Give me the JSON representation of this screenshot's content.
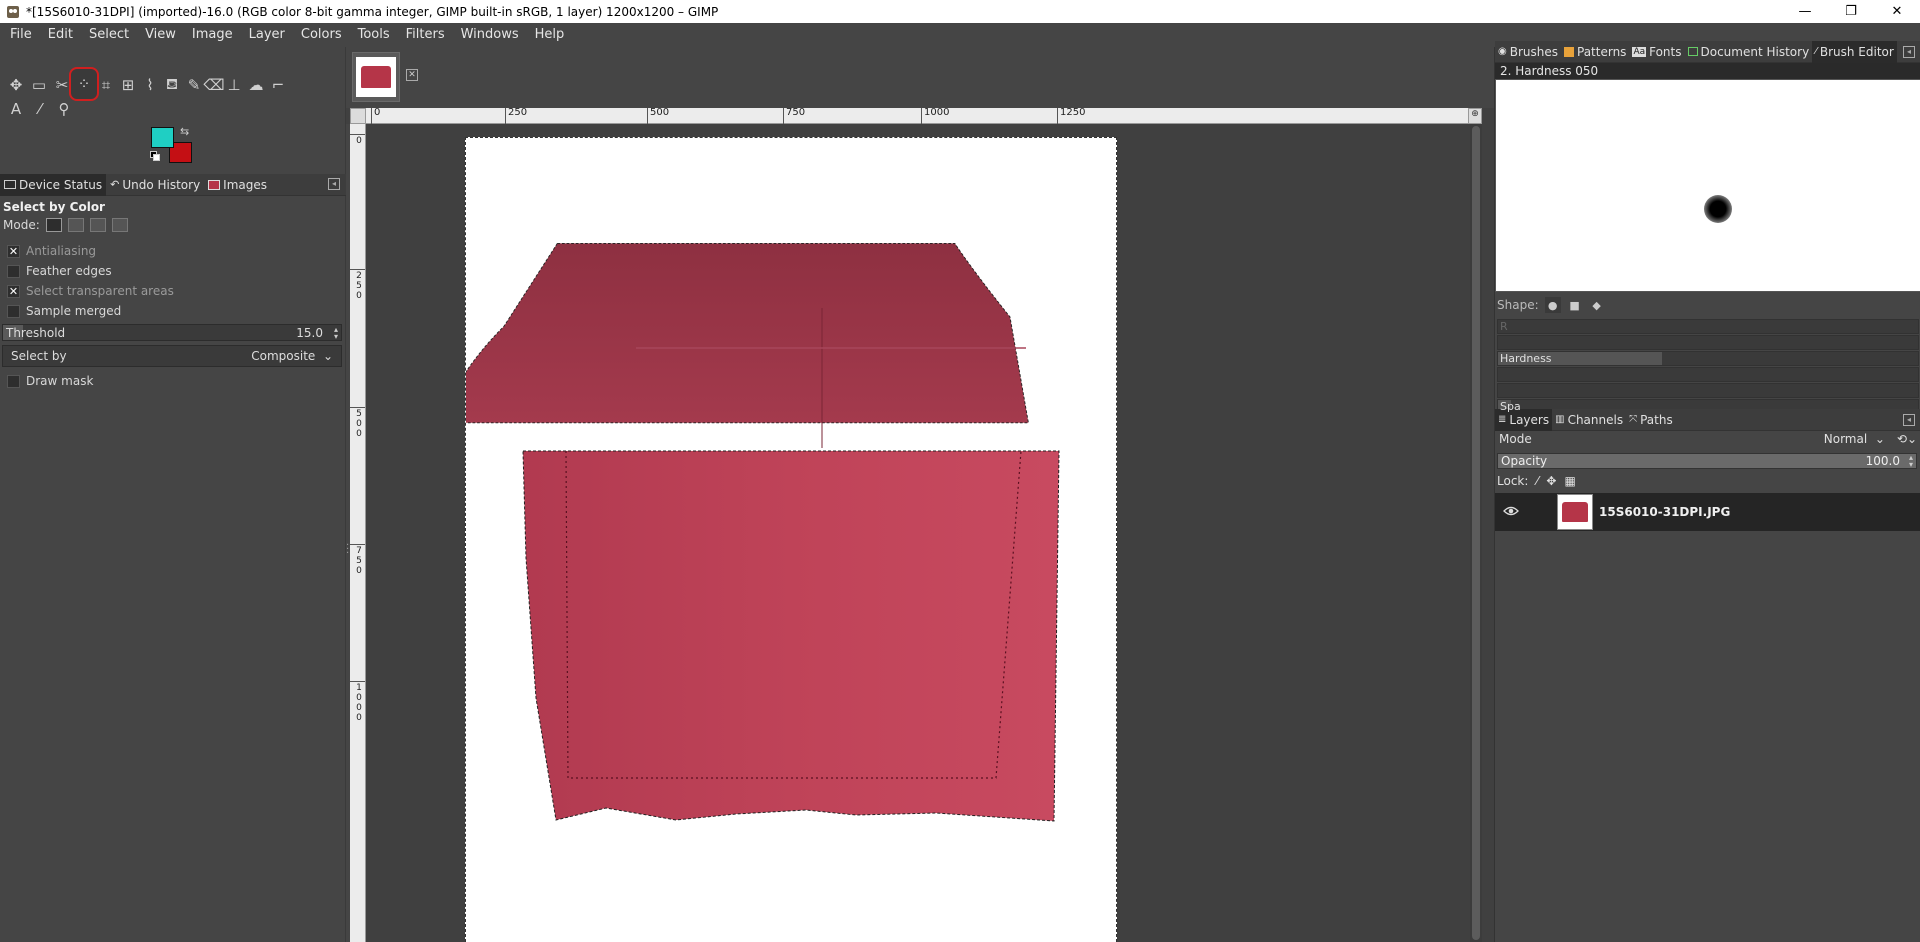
{
  "window": {
    "title": "*[15S6010-31DPI] (imported)-16.0 (RGB color 8-bit gamma integer, GIMP built-in sRGB, 1 layer) 1200x1200 – GIMP",
    "controls": [
      "—",
      "❐",
      "✕"
    ]
  },
  "menu": [
    "File",
    "Edit",
    "Select",
    "View",
    "Image",
    "Layer",
    "Colors",
    "Tools",
    "Filters",
    "Windows",
    "Help"
  ],
  "colors": {
    "foreground": "#1fcfc3",
    "background": "#c40f14",
    "accent": "#d01f1f"
  },
  "toolbox": {
    "tools": [
      {
        "name": "move-tool-icon",
        "glyph": "✥",
        "active": false
      },
      {
        "name": "rect-select-tool-icon",
        "glyph": "▭",
        "active": false
      },
      {
        "name": "scissors-select-tool-icon",
        "glyph": "✂",
        "active": false
      },
      {
        "name": "select-by-color-tool-icon",
        "glyph": "⁘",
        "active": true
      },
      {
        "name": "crop-tool-icon",
        "glyph": "⌗",
        "active": false
      },
      {
        "name": "unified-transform-tool-icon",
        "glyph": "⊞",
        "active": false
      },
      {
        "name": "warp-transform-tool-icon",
        "glyph": "⌇",
        "active": false
      },
      {
        "name": "bucket-fill-tool-icon",
        "glyph": "⛾",
        "active": false
      },
      {
        "name": "paintbrush-tool-icon",
        "glyph": "✎",
        "active": false
      },
      {
        "name": "eraser-tool-icon",
        "glyph": "⌫",
        "active": false
      },
      {
        "name": "clone-tool-icon",
        "glyph": "⊥",
        "active": false
      },
      {
        "name": "smudge-tool-icon",
        "glyph": "☁",
        "active": false
      },
      {
        "name": "paths-tool-icon",
        "glyph": "⌐",
        "active": false
      },
      {
        "name": "text-tool-icon",
        "glyph": "A",
        "active": false
      },
      {
        "name": "color-picker-tool-icon",
        "glyph": "⁄",
        "active": false
      },
      {
        "name": "zoom-tool-icon",
        "glyph": "⚲",
        "active": false
      }
    ]
  },
  "left_tabs": [
    {
      "label": "Device Status",
      "selected": true
    },
    {
      "label": "Undo History",
      "selected": false
    },
    {
      "label": "Images",
      "selected": false
    }
  ],
  "tool_options": {
    "title": "Select by Color",
    "mode_label": "Mode:",
    "antialiasing": {
      "label": "Antialiasing",
      "checked": true
    },
    "feather": {
      "label": "Feather edges",
      "checked": false
    },
    "transparent": {
      "label": "Select transparent areas",
      "checked": true
    },
    "sample_merged": {
      "label": "Sample merged",
      "checked": false
    },
    "threshold": {
      "label": "Threshold",
      "value": "15.0",
      "fraction": 0.06
    },
    "select_by": {
      "label": "Select by",
      "value": "Composite"
    },
    "draw_mask": {
      "label": "Draw mask",
      "checked": false
    }
  },
  "rulers": {
    "top": [
      "0",
      "250",
      "500",
      "750",
      "1000",
      "1250"
    ],
    "left": [
      "0",
      "250",
      "500",
      "750",
      "1000"
    ]
  },
  "right_tabs": [
    {
      "label": "Brushes",
      "selected": false
    },
    {
      "label": "Patterns",
      "selected": false
    },
    {
      "label": "Fonts",
      "selected": false
    },
    {
      "label": "Document History",
      "selected": false
    },
    {
      "label": "Brush Editor",
      "selected": true
    }
  ],
  "brush_editor": {
    "brush_name": "2. Hardness 050",
    "shape_label": "Shape:",
    "params": [
      {
        "label": "R",
        "bright": false,
        "fill": 0.0
      },
      {
        "label": "",
        "bright": false,
        "fill": 0.0
      },
      {
        "label": "Hardness",
        "bright": true,
        "fill": 0.39
      },
      {
        "label": "",
        "bright": false,
        "fill": 0.0
      },
      {
        "label": "",
        "bright": false,
        "fill": 0.0
      },
      {
        "label": "Spa",
        "bright": true,
        "fill": 0.03
      }
    ]
  },
  "layers_tabs": [
    {
      "label": "Layers",
      "selected": true
    },
    {
      "label": "Channels",
      "selected": false
    },
    {
      "label": "Paths",
      "selected": false
    }
  ],
  "layers": {
    "mode_label": "Mode",
    "mode_value": "Normal",
    "opacity_label": "Opacity",
    "opacity_value": "100.0",
    "lock_label": "Lock:",
    "items": [
      {
        "name": "15S6010-31DPI.JPG",
        "visible": true
      }
    ]
  }
}
